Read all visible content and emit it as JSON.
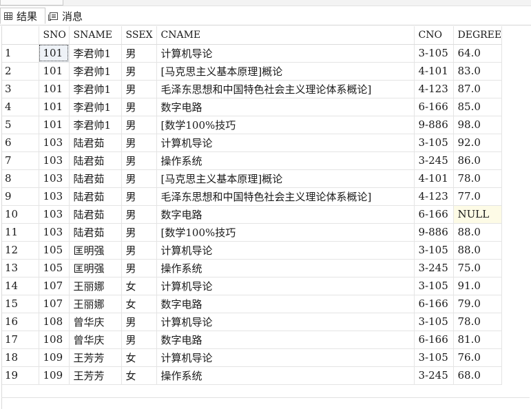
{
  "tabs": {
    "results_label": "结果",
    "messages_label": "消息"
  },
  "grid": {
    "columns": [
      "SNO",
      "SNAME",
      "SSEX",
      "CNAME",
      "CNO",
      "DEGREE"
    ],
    "rows": [
      [
        "1",
        "101",
        "李君帅1",
        "男",
        "计算机导论",
        "3-105",
        "64.0"
      ],
      [
        "2",
        "101",
        "李君帅1",
        "男",
        "[马克思主义基本原理]概论",
        "4-101",
        "83.0"
      ],
      [
        "3",
        "101",
        "李君帅1",
        "男",
        "毛泽东思想和中国特色社会主义理论体系概论]",
        "4-123",
        "87.0"
      ],
      [
        "4",
        "101",
        "李君帅1",
        "男",
        "数字电路",
        "6-166",
        "85.0"
      ],
      [
        "5",
        "101",
        "李君帅1",
        "男",
        "[数学100%技巧",
        "9-886",
        "98.0"
      ],
      [
        "6",
        "103",
        "陆君茹",
        "男",
        "计算机导论",
        "3-105",
        "92.0"
      ],
      [
        "7",
        "103",
        "陆君茹",
        "男",
        "操作系统",
        "3-245",
        "86.0"
      ],
      [
        "8",
        "103",
        "陆君茹",
        "男",
        "[马克思主义基本原理]概论",
        "4-101",
        "78.0"
      ],
      [
        "9",
        "103",
        "陆君茹",
        "男",
        "毛泽东思想和中国特色社会主义理论体系概论]",
        "4-123",
        "77.0"
      ],
      [
        "10",
        "103",
        "陆君茹",
        "男",
        "数字电路",
        "6-166",
        "NULL"
      ],
      [
        "11",
        "103",
        "陆君茹",
        "男",
        "[数学100%技巧",
        "9-886",
        "88.0"
      ],
      [
        "12",
        "105",
        "匡明强",
        "男",
        "计算机导论",
        "3-105",
        "88.0"
      ],
      [
        "13",
        "105",
        "匡明强",
        "男",
        "操作系统",
        "3-245",
        "75.0"
      ],
      [
        "14",
        "107",
        "王丽娜",
        "女",
        "计算机导论",
        "3-105",
        "91.0"
      ],
      [
        "15",
        "107",
        "王丽娜",
        "女",
        "数字电路",
        "6-166",
        "79.0"
      ],
      [
        "16",
        "108",
        "曾华庆",
        "男",
        "计算机导论",
        "3-105",
        "78.0"
      ],
      [
        "17",
        "108",
        "曾华庆",
        "男",
        "数字电路",
        "6-166",
        "81.0"
      ],
      [
        "18",
        "109",
        "王芳芳",
        "女",
        "计算机导论",
        "3-105",
        "76.0"
      ],
      [
        "19",
        "109",
        "王芳芳",
        "女",
        "操作系统",
        "3-245",
        "68.0"
      ]
    ]
  }
}
